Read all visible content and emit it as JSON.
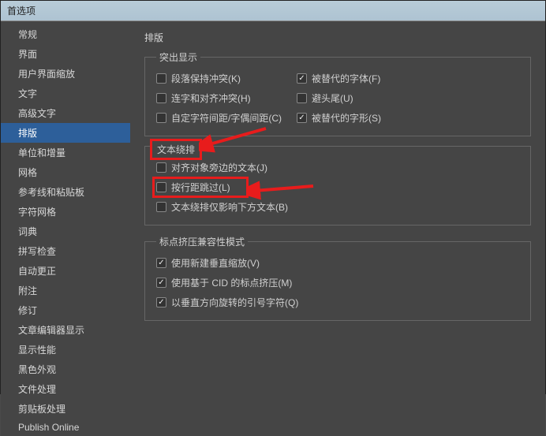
{
  "window": {
    "title": "首选项"
  },
  "sidebar": {
    "items": [
      {
        "label": "常规"
      },
      {
        "label": "界面"
      },
      {
        "label": "用户界面缩放"
      },
      {
        "label": "文字"
      },
      {
        "label": "高级文字"
      },
      {
        "label": "排版"
      },
      {
        "label": "单位和增量"
      },
      {
        "label": "网格"
      },
      {
        "label": "参考线和粘贴板"
      },
      {
        "label": "字符网格"
      },
      {
        "label": "词典"
      },
      {
        "label": "拼写检查"
      },
      {
        "label": "自动更正"
      },
      {
        "label": "附注"
      },
      {
        "label": "修订"
      },
      {
        "label": "文章编辑器显示"
      },
      {
        "label": "显示性能"
      },
      {
        "label": "黑色外观"
      },
      {
        "label": "文件处理"
      },
      {
        "label": "剪贴板处理"
      },
      {
        "label": "Publish Online"
      }
    ],
    "selectedIndex": 5
  },
  "main": {
    "title": "排版",
    "groups": {
      "highlight": {
        "legend": "突出显示",
        "opts": [
          {
            "label": "段落保持冲突(K)",
            "checked": false
          },
          {
            "label": "被替代的字体(F)",
            "checked": true
          },
          {
            "label": "连字和对齐冲突(H)",
            "checked": false
          },
          {
            "label": "避头尾(U)",
            "checked": false
          },
          {
            "label": "自定字符间距/字偶间距(C)",
            "checked": false
          },
          {
            "label": "被替代的字形(S)",
            "checked": true
          }
        ]
      },
      "wrap": {
        "legend": "文本绕排",
        "opts": [
          {
            "label": "对齐对象旁边的文本(J)",
            "checked": false
          },
          {
            "label": "按行距跳过(L)",
            "checked": false
          },
          {
            "label": "文本绕排仅影响下方文本(B)",
            "checked": false
          }
        ]
      },
      "compat": {
        "legend": "标点挤压兼容性模式",
        "opts": [
          {
            "label": "使用新建垂直缩放(V)",
            "checked": true
          },
          {
            "label": "使用基于 CID 的标点挤压(M)",
            "checked": true
          },
          {
            "label": "以垂直方向旋转的引号字符(Q)",
            "checked": true
          }
        ]
      }
    }
  }
}
